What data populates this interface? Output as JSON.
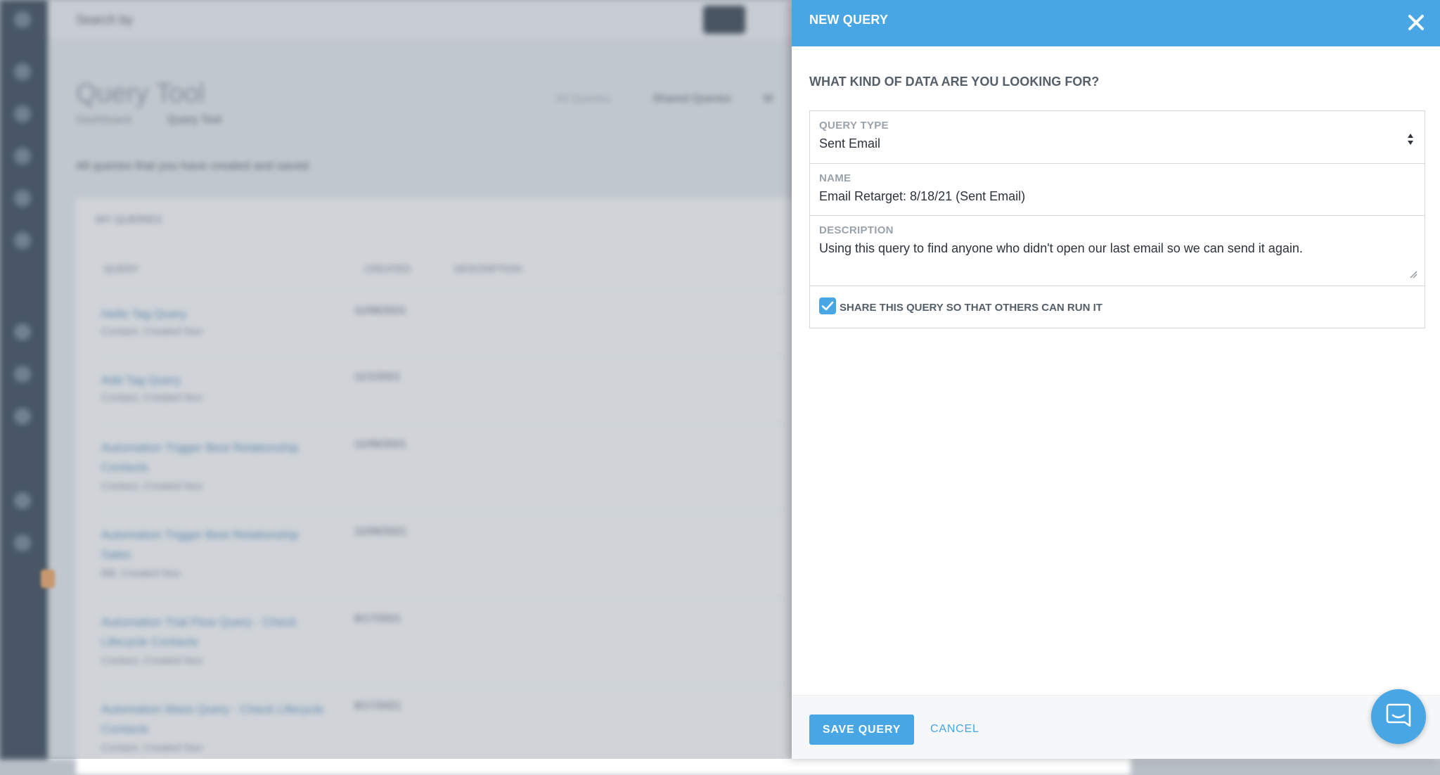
{
  "background": {
    "search_label": "Search by",
    "title": "Query Tool",
    "breadcrumb": [
      "Dashboard",
      "Query Tool"
    ],
    "intro": "All queries that you have created and saved",
    "tabs": [
      "All Queries",
      "Shared Queries",
      "M"
    ],
    "card_heading": "MY QUERIES",
    "columns": [
      "QUERY",
      "CREATED",
      "DESCRIPTION"
    ],
    "rows": [
      {
        "name": "Hello Tag Query",
        "sub": "Contact, Created Nov",
        "date": "11/06/2021"
      },
      {
        "name": "Add Tag Query",
        "sub": "Contact, Created Nov",
        "date": "11/1/2021"
      },
      {
        "name": "Automation Trigger Best Relationship Contacts",
        "sub": "Contact, Created Nov",
        "date": "11/06/2021"
      },
      {
        "name": "Automation Trigger Best Relationship Sales",
        "sub": "Bill, Created Nov",
        "date": "11/06/2021"
      },
      {
        "name": "Automation Trial Flow Query - Check Lifecycle Contacts",
        "sub": "Contact, Created Nov",
        "date": "8/17/2021"
      },
      {
        "name": "Automation Mass Query - Check Lifecycle Contacts",
        "sub": "Contact, Created Nov",
        "date": "8/17/2021"
      }
    ]
  },
  "panel": {
    "title": "NEW QUERY",
    "question": "WHAT KIND OF DATA ARE YOU LOOKING FOR?",
    "query_type": {
      "label": "QUERY TYPE",
      "value": "Sent Email"
    },
    "name": {
      "label": "NAME",
      "value": "Email Retarget: 8/18/21 (Sent Email)"
    },
    "description": {
      "label": "DESCRIPTION",
      "value": "Using this query to find anyone who didn't open our last email so we can send it again."
    },
    "share": {
      "label": "SHARE THIS QUERY SO THAT OTHERS CAN RUN IT",
      "checked": true
    },
    "save_label": "SAVE QUERY",
    "cancel_label": "CANCEL"
  },
  "colors": {
    "accent": "#47a6e3",
    "sidebar": "#2e3e4e",
    "text_dark": "#2d3339",
    "label_gray": "#9aa3ab"
  },
  "icons": {
    "close": "close-icon",
    "select": "select-arrows-icon",
    "check": "checkmark-icon",
    "chat": "chat-bubble-icon"
  }
}
